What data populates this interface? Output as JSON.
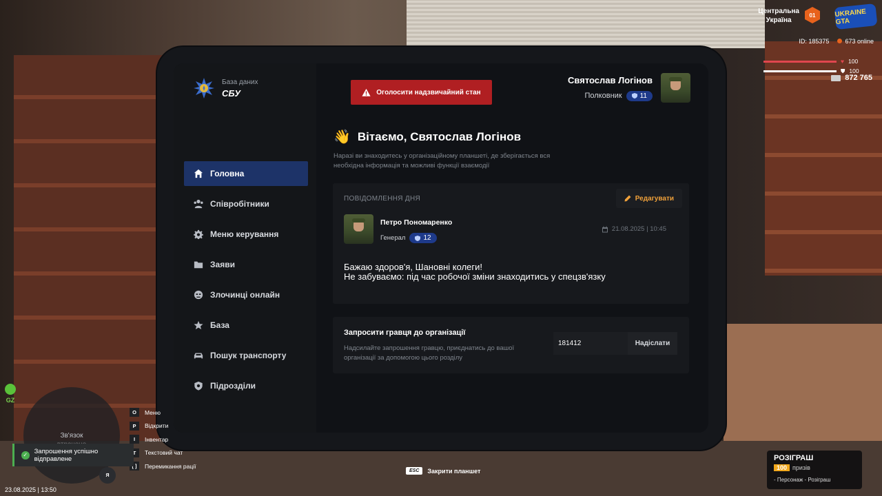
{
  "brand": {
    "subtitle": "База даних",
    "title": "СБУ"
  },
  "alert_button": {
    "label": "Оголосити надзвичайний стан"
  },
  "profile": {
    "name": "Святослав Логінов",
    "rank": "Полковник",
    "level": "11"
  },
  "nav": {
    "items": [
      {
        "label": "Головна",
        "icon": "home-icon",
        "active": true
      },
      {
        "label": "Співробітники",
        "icon": "users-icon",
        "active": false
      },
      {
        "label": "Меню керування",
        "icon": "gear-icon",
        "active": false
      },
      {
        "label": "Заяви",
        "icon": "folder-icon",
        "active": false
      },
      {
        "label": "Злочинці онлайн",
        "icon": "criminal-icon",
        "active": false
      },
      {
        "label": "База",
        "icon": "star-icon",
        "active": false
      },
      {
        "label": "Пошук транспорту",
        "icon": "car-icon",
        "active": false
      },
      {
        "label": "Підрозділи",
        "icon": "shield-icon",
        "active": false
      }
    ]
  },
  "greeting": {
    "wave": "👋",
    "text": "Вітаємо, Святослав Логінов"
  },
  "intro": "Наразі ви знаходитесь у організаційному планшеті, де зберігається вся необхідна інформація та можливі функції взаємодії",
  "motd": {
    "label": "ПОВІДОМЛЕННЯ ДНЯ",
    "edit_label": "Редагувати",
    "author_name": "Петро Пономаренко",
    "author_rank": "Генерал",
    "author_level": "12",
    "date": "21.08.2025 | 10:45",
    "line1": "Бажаю здоров'я, Шановні колеги!",
    "line2": "Не забуваємо: під час робочої зміни знаходитись у спецзв'язку"
  },
  "invite": {
    "title": "Запросити гравця до організації",
    "description": "Надсилайте запрошення гравцю, приєднатись до вашої організації за допомогою цього розділу",
    "input_value": "181412",
    "send_label": "Надіслати"
  },
  "hud": {
    "region_line1": "Центральна",
    "region_line2": "Україна",
    "region_logo": "01",
    "game_logo": "UKRAINE GTA",
    "player_id": "ID: 185375",
    "online": "673 online",
    "health": "100",
    "armor": "100",
    "health_fraction": 1.0,
    "armor_fraction": 1.0,
    "money": "872 765",
    "gz": "GZ",
    "map_status_line1": "Зв'язок",
    "map_status_line2": "втрачено",
    "keys": [
      {
        "key": "O",
        "label": "Меню"
      },
      {
        "key": "P",
        "label": "Відкрити"
      },
      {
        "key": "I",
        "label": "Інвентар"
      },
      {
        "key": "T",
        "label": "Текстовий чат"
      },
      {
        "key": "[ ]",
        "label": "Перемикання рації"
      }
    ],
    "toast": "Запрошення успішно відправлене",
    "mic_key": "Я",
    "datetime": "23.08.2025 | 13:50",
    "esc_key": "ESC",
    "esc_label": "Закрити планшет",
    "raffle_title": "РОЗІГРАШ",
    "raffle_count": "100",
    "raffle_word": "призів",
    "raffle_hint": "- Персонаж - Розіграш"
  },
  "colors": {
    "accent": "#1d3368",
    "alert": "#b01f22",
    "edit": "#f0a13a",
    "health": "#e0464e",
    "armor": "#ffffff"
  }
}
